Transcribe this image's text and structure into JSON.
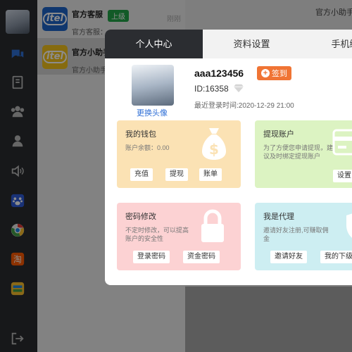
{
  "chat_list": [
    {
      "name": "官方客服",
      "badge": "上级",
      "msg": "官方客服：",
      "time": "刚刚"
    },
    {
      "name": "官方小助手",
      "msg": "官方小助手"
    }
  ],
  "right_header": {
    "title": "官方小助手"
  },
  "modal": {
    "tabs": [
      "个人中心",
      "资料设置",
      "手机绑定"
    ],
    "profile": {
      "change_avatar": "更换头像",
      "username": "aaa123456",
      "checkin": "签到",
      "id": "ID:16358",
      "last_login": "最近登录时间:2020-12-29 21:00"
    },
    "cards": {
      "wallet": {
        "title": "我的钱包",
        "desc": "账户余额：0.00",
        "buttons": [
          "充值",
          "提现",
          "账单"
        ]
      },
      "withdraw": {
        "title": "提现账户",
        "desc": "为了方便您申请提现，建议及时绑定提现账户",
        "buttons": [
          "设置"
        ]
      },
      "password": {
        "title": "密码修改",
        "desc": "不定时修改，可以提高账户的安全性",
        "buttons": [
          "登录密码",
          "资金密码"
        ]
      },
      "agent": {
        "title": "我是代理",
        "desc": "邀请好友注册,可赚取佣金",
        "buttons": [
          "邀请好友",
          "我的下级"
        ]
      }
    }
  },
  "colors": {
    "sidebar": "#2b2d31",
    "accent_orange": "#f07434",
    "link_blue": "#2f6fd6"
  }
}
